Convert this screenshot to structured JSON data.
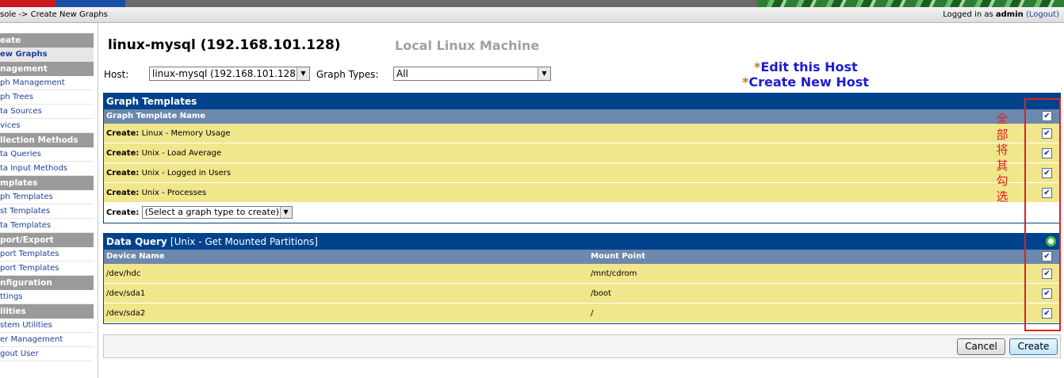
{
  "header": {
    "breadcrumb": "sole -> Create New Graphs",
    "logged_in_prefix": "Logged in as ",
    "user": "admin",
    "logout": "(Logout)"
  },
  "menu": {
    "sections": [
      {
        "title": "eate",
        "items": [
          {
            "label": "ew Graphs",
            "selected": true
          }
        ]
      },
      {
        "title": "nagement",
        "items": [
          {
            "label": "ph Management"
          },
          {
            "label": "ph Trees"
          },
          {
            "label": "ta Sources"
          },
          {
            "label": "vices"
          }
        ]
      },
      {
        "title": "llection Methods",
        "items": [
          {
            "label": "ta Queries"
          },
          {
            "label": "ta Input Methods"
          }
        ]
      },
      {
        "title": "mplates",
        "items": [
          {
            "label": "ph Templates"
          },
          {
            "label": "st Templates"
          },
          {
            "label": "ta Templates"
          }
        ]
      },
      {
        "title": "port/Export",
        "items": [
          {
            "label": "port Templates"
          },
          {
            "label": "port Templates"
          }
        ]
      },
      {
        "title": "nfiguration",
        "items": [
          {
            "label": "ttings"
          }
        ]
      },
      {
        "title": "ilities",
        "items": [
          {
            "label": "stem Utilities"
          },
          {
            "label": "er Management"
          },
          {
            "label": "gout User"
          }
        ]
      }
    ]
  },
  "host": {
    "title": "linux-mysql (192.168.101.128)",
    "description": "Local Linux Machine",
    "host_label": "Host:",
    "host_value": "linux-mysql (192.168.101.128)",
    "graph_types_label": "Graph Types:",
    "graph_types_value": "All",
    "edit_link": "Edit this Host",
    "create_link": "Create New Host"
  },
  "graph_templates": {
    "title": "Graph Templates",
    "column": "Graph Template Name",
    "create_prefix": "Create:",
    "rows": [
      {
        "name": "Linux - Memory Usage",
        "checked": true
      },
      {
        "name": "Unix - Load Average",
        "checked": true
      },
      {
        "name": "Unix - Logged in Users",
        "checked": true
      },
      {
        "name": "Unix - Processes",
        "checked": true
      }
    ],
    "create_select": "(Select a graph type to create)"
  },
  "data_query": {
    "title": "Data Query",
    "name": "[Unix - Get Mounted Partitions]",
    "columns": [
      "Device Name",
      "Mount Point"
    ],
    "rows": [
      {
        "device": "/dev/hdc",
        "mount": "/mnt/cdrom",
        "checked": true
      },
      {
        "device": "/dev/sda1",
        "mount": "/boot",
        "checked": true
      },
      {
        "device": "/dev/sda2",
        "mount": "/",
        "checked": true
      }
    ]
  },
  "buttons": {
    "cancel": "Cancel",
    "create": "Create"
  },
  "annotation": {
    "text": "全部将其勾选"
  },
  "colors": {
    "panel_blue": "#00438c",
    "row_yellow": "#f0e68c",
    "annotation_red": "#e02020"
  }
}
